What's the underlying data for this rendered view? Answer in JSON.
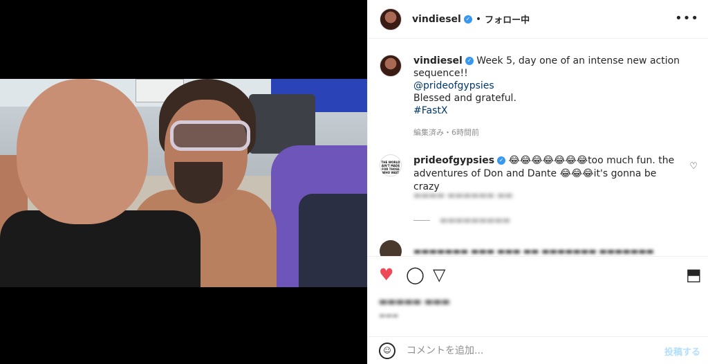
{
  "post": {
    "author": "vindiesel",
    "follow_status": "フォロー中",
    "separator": "•",
    "more_label": "•••"
  },
  "caption": {
    "username": "vindiesel",
    "text_line1": "Week 5, day one of an intense new action sequence!!",
    "mention": "@prideofgypsies",
    "text_line2": "Blessed and grateful.",
    "hashtag": "#FastX",
    "meta": "編集済み・6時間前"
  },
  "comment": {
    "username": "prideofgypsies",
    "emoji_run1": "😂😂😂😂😂😂😂",
    "text1": "too much fun. the adventures of Don and Dante ",
    "emoji_run2": "😂😂😂",
    "text2": "it's gonna be crazy",
    "avatar_text": "THE WORLD AIN'T MADE FOR THOSE WHO WAIT"
  },
  "actions": {
    "like_icon": "♥",
    "comment_icon": "◯",
    "share_icon": "▽",
    "save_icon": "⬒"
  },
  "add_comment": {
    "placeholder": "コメントを追加...",
    "post_label": "投稿する",
    "emoji_icon": "☺"
  },
  "icons": {
    "verified": "✓",
    "heart_outline": "♡"
  },
  "colors": {
    "like_red": "#ed4956",
    "verified_blue": "#3897f0",
    "link_blue": "#00376b",
    "post_disabled": "#b2dffc"
  }
}
